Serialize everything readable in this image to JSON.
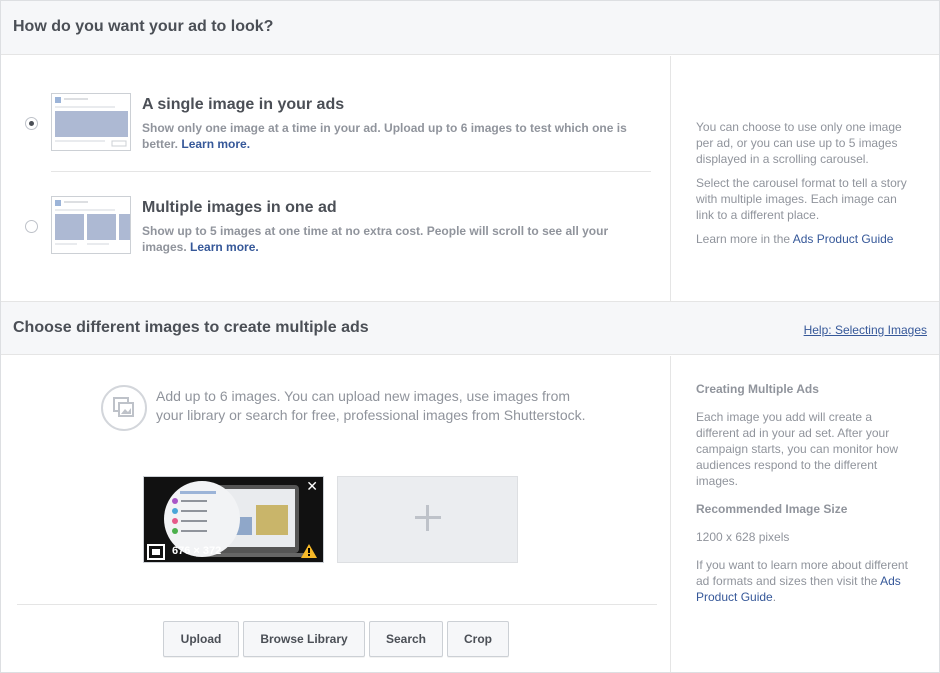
{
  "section1": {
    "title": "How do you want your ad to look?",
    "options": [
      {
        "title": "A single image in your ads",
        "desc": "Show only one image at a time in your ad. Upload up to 6 images to test which one is better.",
        "link": "Learn more.",
        "selected": true
      },
      {
        "title": "Multiple images in one ad",
        "desc": "Show up to 5 images at one time at no extra cost. People will scroll to see all your images.",
        "link": "Learn more.",
        "selected": false
      }
    ],
    "sidebar": {
      "p1": "You can choose to use only one image per ad, or you can use up to 5 images displayed in a scrolling carousel.",
      "p2": "Select the carousel format to tell a story with multiple images. Each image can link to a different place.",
      "p3_prefix": "Learn more in the",
      "p3_link": "Ads Product Guide"
    }
  },
  "section2": {
    "title": "Choose different images to create multiple ads",
    "help_link": "Help: Selecting Images",
    "info": "Add up to 6 images. You can upload new images, use images from your library or search for free, professional images from Shutterstock.",
    "image_tile": {
      "dimensions": "676 × 372",
      "close": "✕"
    },
    "buttons": {
      "upload": "Upload",
      "browse": "Browse Library",
      "search": "Search",
      "crop": "Crop"
    },
    "sidebar": {
      "heading1": "Creating Multiple Ads",
      "p1": "Each image you add will create a different ad in your ad set. After your campaign starts, you can monitor how audiences respond to the different images.",
      "heading2": "Recommended Image Size",
      "size": "1200 x 628 pixels",
      "p3_prefix": "If you want to learn more about different ad formats and sizes then visit the",
      "p3_link": "Ads Product Guide",
      "p3_suffix": "."
    }
  },
  "colors": {
    "link": "#365899",
    "text": "#4b4f56",
    "muted": "#90949c",
    "border": "#dddfe2",
    "header_bg": "#f6f7f9",
    "warning": "#f7b928"
  }
}
